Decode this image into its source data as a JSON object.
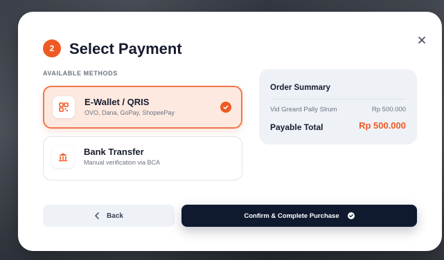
{
  "modal": {
    "step_number": "2",
    "title": "Select Payment",
    "section_label": "AVAILABLE METHODS"
  },
  "methods": [
    {
      "name": "E-Wallet / QRIS",
      "description": "OVO, Dana, GoPay, ShopeePay",
      "icon": "qr-code-icon",
      "selected": true
    },
    {
      "name": "Bank Transfer",
      "description": "Manual verification via BCA",
      "icon": "bank-icon",
      "selected": false
    }
  ],
  "summary": {
    "title": "Order Summary",
    "item_name": "Vid Greard Pally Slrum",
    "item_price": "Rp 500.000",
    "total_label": "Payable Total",
    "total_amount": "Rp 500.000"
  },
  "actions": {
    "back_label": "Back",
    "confirm_label": "Confirm & Complete Purchase"
  },
  "colors": {
    "accent": "#ef5a24",
    "selected_bg": "#fde9df",
    "dark": "#101a2f",
    "summary_bg": "#eef1f6"
  }
}
